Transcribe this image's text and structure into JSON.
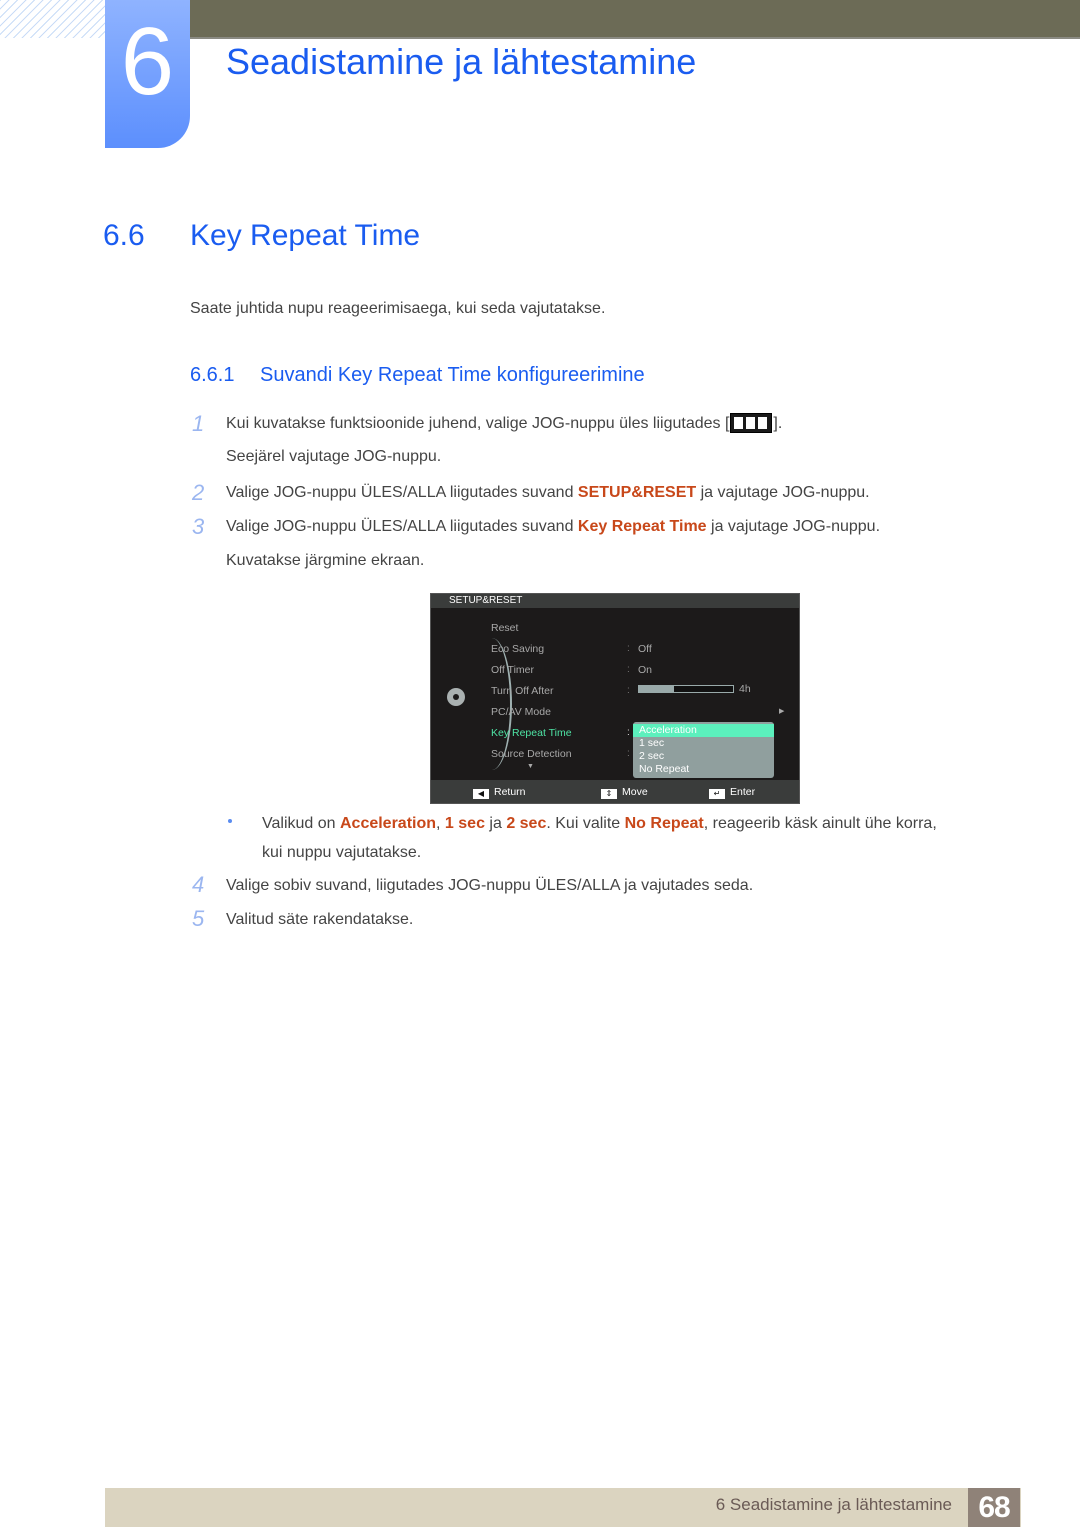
{
  "chapter": {
    "number": "6",
    "title": "Seadistamine ja lähtestamine"
  },
  "section": {
    "number": "6.6",
    "title": "Key Repeat Time",
    "intro": "Saate juhtida nupu reageerimisaega, kui seda vajutatakse."
  },
  "subsection": {
    "number": "6.6.1",
    "title": "Suvandi Key Repeat Time konfigureerimine"
  },
  "steps": [
    {
      "num": "1",
      "line1_pre": "Kui kuvatakse funktsioonide juhend, valige JOG-nuppu üles liigutades [",
      "line1_post": "].",
      "line2": "Seejärel vajutage JOG-nuppu.",
      "icon": "jog-menu-icon"
    },
    {
      "num": "2",
      "pre": "Valige JOG-nuppu ÜLES/ALLA liigutades suvand ",
      "hl": "SETUP&RESET",
      "post": " ja vajutage JOG-nuppu."
    },
    {
      "num": "3",
      "pre": "Valige JOG-nuppu ÜLES/ALLA liigutades suvand ",
      "hl": "Key Repeat Time",
      "post": " ja vajutage JOG-nuppu.",
      "line2": "Kuvatakse järgmine ekraan."
    },
    {
      "num": "4",
      "text": "Valige sobiv suvand, liigutades JOG-nuppu ÜLES/ALLA ja vajutades seda."
    },
    {
      "num": "5",
      "text": "Valitud säte rakendatakse."
    }
  ],
  "note": {
    "p1": "Valikud on ",
    "h1": "Acceleration",
    "p2": ", ",
    "h2": "1 sec",
    "p3": " ja ",
    "h3": "2 sec",
    "p4": ". Kui valite ",
    "h4": "No Repeat",
    "p5": ", reageerib käsk ainult ühe korra,",
    "line2": "kui nuppu vajutatakse."
  },
  "osd": {
    "title": "SETUP&RESET",
    "items": [
      {
        "label": "Reset",
        "value": ""
      },
      {
        "label": "Eco Saving",
        "value": "Off"
      },
      {
        "label": "Off Timer",
        "value": "On"
      },
      {
        "label": "Turn Off After",
        "value": "4h",
        "progress": 0.37
      },
      {
        "label": "PC/AV Mode",
        "value": ""
      },
      {
        "label": "Key Repeat Time",
        "value": "",
        "active": true
      },
      {
        "label": "Source Detection",
        "value": ""
      }
    ],
    "dropdown": [
      "Acceleration",
      "1 sec",
      "2 sec",
      "No Repeat"
    ],
    "dropdown_selected": "Acceleration",
    "footer": {
      "return": "Return",
      "move": "Move",
      "enter": "Enter"
    },
    "colors": {
      "active": "#4ee3a4",
      "selected_bg": "#5cf0bd"
    }
  },
  "footer": {
    "text": "6 Seadistamine ja lähtestamine",
    "page": "68"
  },
  "colors": {
    "heading": "#1a5cf0",
    "highlight": "#c8481a",
    "topbar": "#6c6b56"
  }
}
